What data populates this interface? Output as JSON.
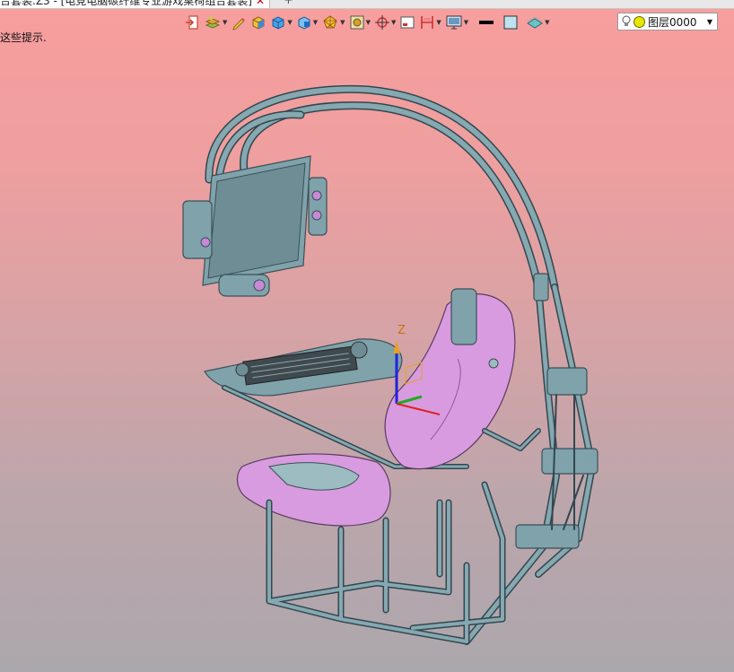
{
  "tab": {
    "title": "合套装.Z3 - [电竞电脑碳纤维专业游戏桌椅组合套装]",
    "close_glyph": "✕",
    "add_glyph": "+"
  },
  "toolbar": {
    "icons": [
      "exit-icon",
      "layers-icon",
      "pencil-icon",
      "shaded-box-icon",
      "solid-box-icon",
      "view-box-icon",
      "wireframe-ball-icon",
      "render-mode-icon",
      "target-icon",
      "view-frame-icon",
      "split-icon",
      "display-icon",
      "line-color-icon",
      "fill-color-icon",
      "surface-color-icon"
    ],
    "line_color": "#000000",
    "fill_color": "#bde3ee"
  },
  "layer": {
    "value": "图层0000",
    "dot_color": "#e6e600"
  },
  "hint_text": "这些提示.",
  "triad": {
    "z_label": "Z"
  },
  "colors": {
    "frame": "#7fa2ab",
    "seat": "#d89be0",
    "axis_z": "#2222dd",
    "axis_x": "#dd2222",
    "axis_y": "#22aa22"
  }
}
